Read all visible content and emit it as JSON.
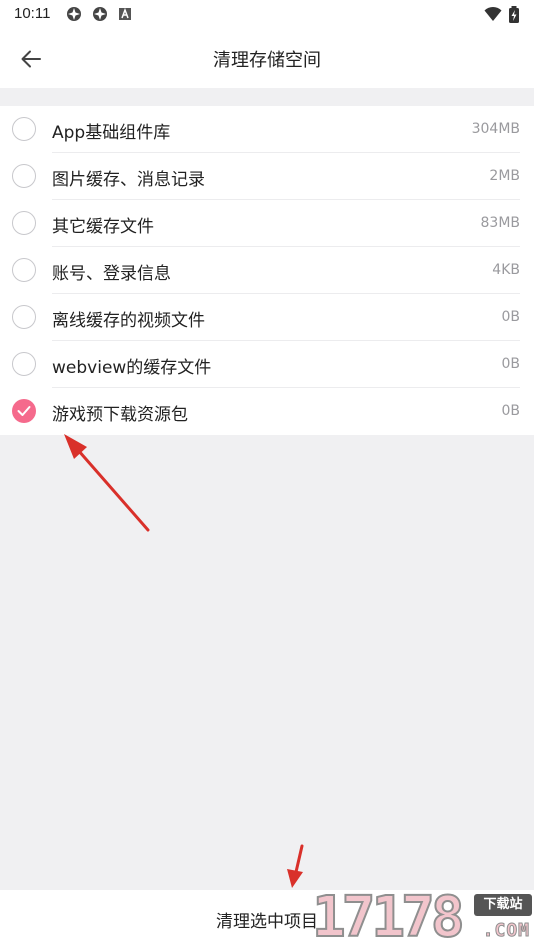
{
  "status_bar": {
    "time": "10:11",
    "left_icons": [
      "app-notification-icon",
      "app-notification-icon",
      "android-a-icon"
    ],
    "right_icons": [
      "wifi-icon",
      "battery-charging-icon"
    ]
  },
  "header": {
    "back_icon": "back-arrow-icon",
    "title": "清理存储空间"
  },
  "items": [
    {
      "label": "App基础组件库",
      "size": "304MB",
      "checked": false
    },
    {
      "label": "图片缓存、消息记录",
      "size": "2MB",
      "checked": false
    },
    {
      "label": "其它缓存文件",
      "size": "83MB",
      "checked": false
    },
    {
      "label": "账号、登录信息",
      "size": "4KB",
      "checked": false
    },
    {
      "label": "离线缓存的视频文件",
      "size": "0B",
      "checked": false
    },
    {
      "label": "webview的缓存文件",
      "size": "0B",
      "checked": false
    },
    {
      "label": "游戏预下载资源包",
      "size": "0B",
      "checked": true
    }
  ],
  "bottom": {
    "clean_label": "清理选中项目"
  },
  "watermark": {
    "number": "17178",
    "badge": "下载站",
    "domain": ".COM"
  },
  "colors": {
    "accent": "#f56a8c",
    "annotation_arrow": "#d9302a",
    "background": "#f0f0f2"
  }
}
